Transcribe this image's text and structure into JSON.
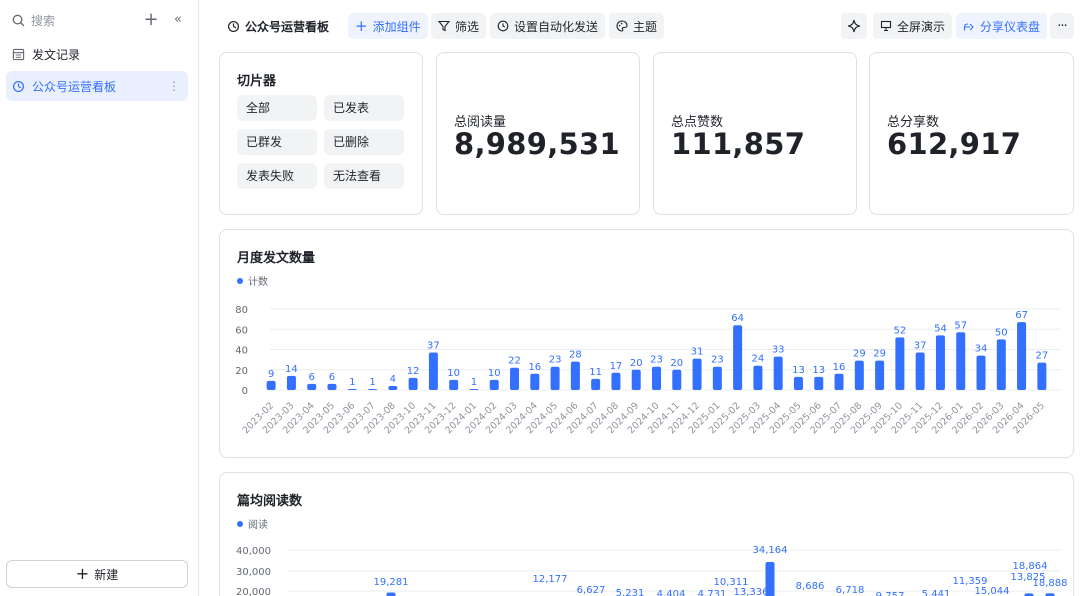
{
  "sidebar": {
    "search_placeholder": "搜索",
    "items": [
      {
        "label": "发文记录",
        "icon": "table-icon",
        "active": false
      },
      {
        "label": "公众号运营看板",
        "icon": "dashboard-icon",
        "active": true
      }
    ],
    "new_label": "新建"
  },
  "toolbar": {
    "title": "公众号运营看板",
    "add_widget": "添加组件",
    "filter": "筛选",
    "auto_send": "设置自动化发送",
    "theme": "主题",
    "fullscreen": "全屏演示",
    "share": "分享仪表盘"
  },
  "slicer": {
    "title": "切片器",
    "options": [
      "全部",
      "已发表",
      "已群发",
      "已删除",
      "发表失败",
      "无法查看"
    ]
  },
  "kpis": [
    {
      "label": "总阅读量",
      "value": "8,989,531"
    },
    {
      "label": "总点赞数",
      "value": "111,857"
    },
    {
      "label": "总分享数",
      "value": "612,917"
    }
  ],
  "colors": {
    "accent": "#3370ff"
  },
  "chart_data": [
    {
      "type": "bar",
      "title": "月度发文数量",
      "legend": "计数",
      "ylim": [
        0,
        80
      ],
      "yticks": [
        0,
        20,
        40,
        60,
        80
      ],
      "categories": [
        "2023-02",
        "2023-03",
        "2023-04",
        "2023-05",
        "2023-06",
        "2023-07",
        "2023-08",
        "2023-10",
        "2023-11",
        "2023-12",
        "2024-01",
        "2024-02",
        "2024-03",
        "2024-04",
        "2024-05",
        "2024-06",
        "2024-07",
        "2024-08",
        "2024-09",
        "2024-10",
        "2024-11",
        "2024-12",
        "2025-01",
        "2025-02",
        "2025-03",
        "2025-04",
        "2025-05",
        "2025-06",
        "2025-07",
        "2025-08",
        "2025-09",
        "2025-10",
        "2025-11",
        "2025-12",
        "2026-01",
        "2026-02",
        "2026-03",
        "2026-04",
        "2026-05"
      ],
      "values": [
        9,
        14,
        6,
        6,
        1,
        1,
        4,
        12,
        37,
        10,
        1,
        10,
        22,
        16,
        23,
        28,
        11,
        17,
        20,
        23,
        20,
        31,
        23,
        64,
        24,
        33,
        13,
        13,
        16,
        29,
        29,
        52,
        37,
        54,
        57,
        34,
        50,
        67,
        27
      ]
    },
    {
      "type": "bar",
      "title": "篇均阅读数",
      "legend": "阅读",
      "ylim": [
        0,
        40000
      ],
      "yticks_visible": [
        "40,000",
        "30,000",
        "20,000"
      ],
      "visible_labels": [
        "19,281",
        "12,177",
        "6,627",
        "5,231",
        "4,404",
        "4,731",
        "10,311",
        "13,336",
        "34,164",
        "8,686",
        "6,718",
        "9,757",
        "5,441",
        "11,359",
        "15,044",
        "13,825",
        "18,864",
        "18,888"
      ]
    }
  ]
}
